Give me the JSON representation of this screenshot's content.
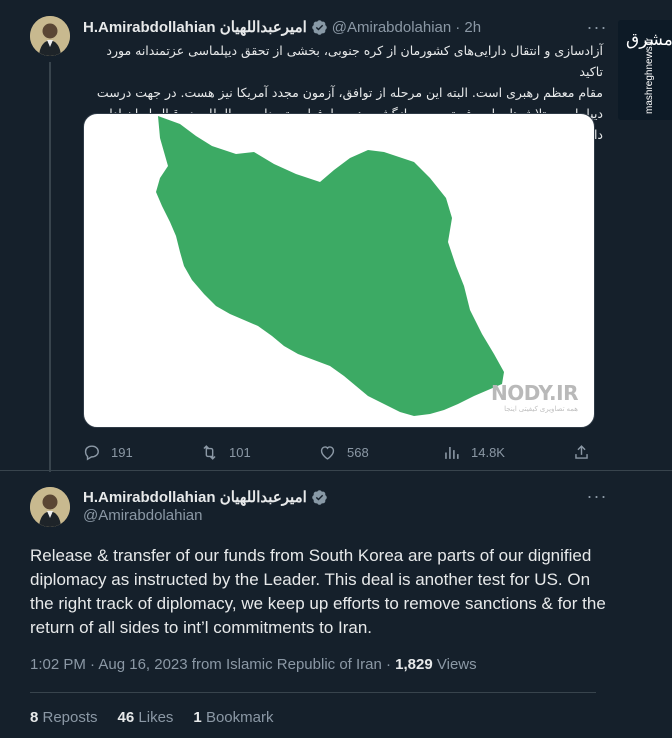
{
  "tweet_reply": {
    "display_name": "H.Amirabdollahian امیرعبداللهیان",
    "handle": "@Amirabdolahian",
    "time": "· 2h",
    "text_lines": [
      "آزادسازی و انتقال دارایی‌های کشورمان از کره جنوبی، بخشی از تحقق دیپلماسی عزتمندانه مورد تاکید",
      "مقام معظم رهبری است. البته این مرحله از توافق، آزمون مجدد آمریکا نیز هست. در جهت درست",
      "دیپلماسی،  تلاش‌ها برای رفع تحریم و بازگشت همه طرفها به تعهدات بین‌المللی در قبال ایران ادامه دارد."
    ],
    "media_watermark": "NODY.IR",
    "media_watermark_sub": "همه تصاویری کیفیتی اینجا",
    "actions": {
      "replies": "191",
      "reposts": "101",
      "likes": "568",
      "views": "14.8K"
    }
  },
  "main_tweet": {
    "display_name": "H.Amirabdollahian امیرعبداللهیان",
    "handle": "@Amirabdolahian",
    "text": "Release & transfer of our funds from South Korea are parts of our dignified diplomacy as instructed by the Leader. This deal is another test for US. On the right track of diplomacy, we keep up efforts to remove sanctions & for the return of all sides to int’l commitments to Iran.",
    "timestamp": "1:02 PM · Aug 16, 2023 from Islamic Republic of Iran · ",
    "views_count": "1,829",
    "views_label": " Views",
    "reposts_count": "8",
    "reposts_label": " Reposts",
    "likes_count": "46",
    "likes_label": " Likes",
    "bookmarks_count": "1",
    "bookmarks_label": "Bookmark"
  },
  "site_logo": {
    "mark": "مشرق",
    "url": "mashreghnews.ir"
  },
  "colors": {
    "background": "#15202b",
    "map_green": "#3caa64",
    "muted_text": "#8b98a5",
    "verified_blue": "#8899a6"
  }
}
